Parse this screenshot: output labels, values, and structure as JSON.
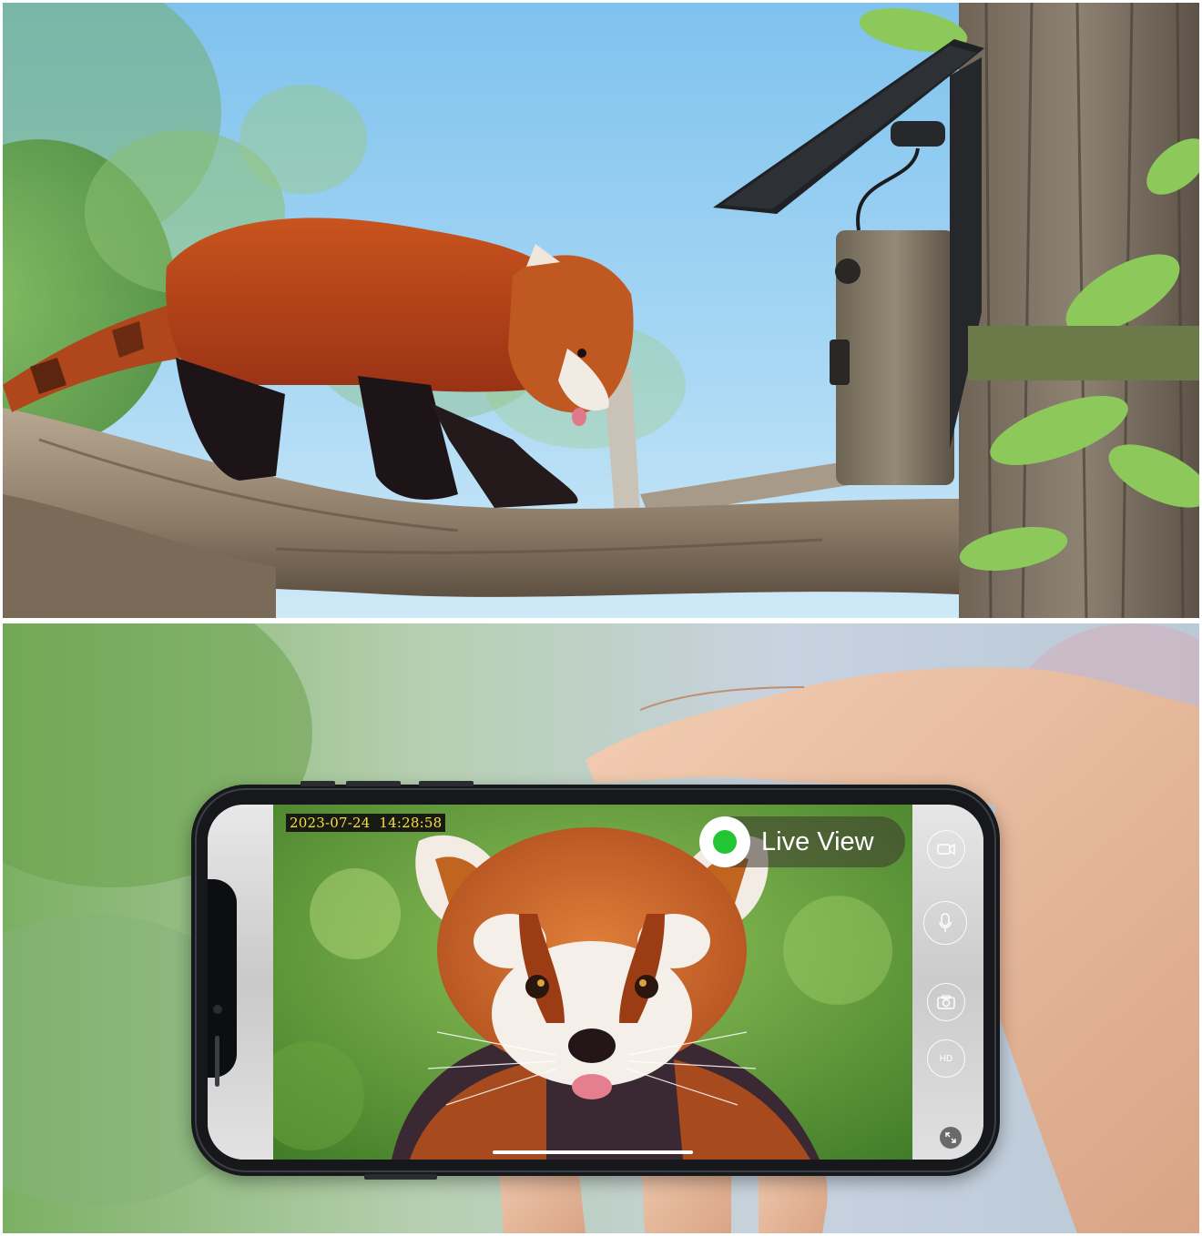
{
  "top_panel": {
    "scene": [
      "red-panda",
      "tree-branch",
      "tree-trunk",
      "trail-camera",
      "solar-panel",
      "sky",
      "leaves"
    ]
  },
  "bottom_panel": {
    "scene": [
      "blurred-background",
      "hand",
      "smartphone"
    ],
    "phone_screen": {
      "timestamp": "2023-07-24  14:28:58",
      "live_label": "Live View",
      "live_status_color": "#22c534",
      "controls": [
        {
          "icon": "video-record-icon"
        },
        {
          "icon": "microphone-icon"
        },
        {
          "icon": "camera-snapshot-icon"
        },
        {
          "icon": "hd-toggle-icon",
          "label": "HD"
        },
        {
          "icon": "fullscreen-icon"
        }
      ]
    }
  }
}
